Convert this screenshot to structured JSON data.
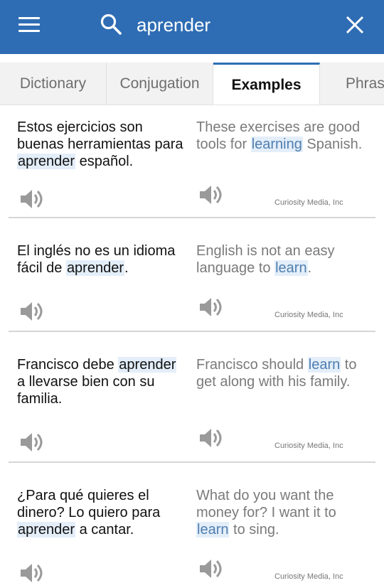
{
  "search": {
    "query": "aprender"
  },
  "tabs": [
    {
      "label": "Dictionary",
      "active": false
    },
    {
      "label": "Conjugation",
      "active": false
    },
    {
      "label": "Examples",
      "active": true
    },
    {
      "label": "Phrases",
      "active": false
    }
  ],
  "examples": [
    {
      "es_before": "Estos ejercicios son buenas herramientas para ",
      "es_highlight": "aprender",
      "es_after": " español.",
      "en_before": "These exercises are good tools for ",
      "en_highlight": "learning",
      "en_after": " Spanish.",
      "credit": "Curiosity Media, Inc"
    },
    {
      "es_before": "El inglés no es un idioma fácil de ",
      "es_highlight": "aprender",
      "es_after": ".",
      "en_before": "English is not an easy language to ",
      "en_highlight": "learn",
      "en_after": ".",
      "credit": "Curiosity Media, Inc"
    },
    {
      "es_before": "Francisco debe ",
      "es_highlight": "aprender",
      "es_after": " a llevarse bien con su familia.",
      "en_before": "Francisco should ",
      "en_highlight": "learn",
      "en_after": " to get along with his family.",
      "credit": "Curiosity Media, Inc"
    },
    {
      "es_before": "¿Para qué quieres el dinero? Lo quiero para ",
      "es_highlight": "aprender",
      "es_after": " a cantar.",
      "en_before": "What do you want the money for? I want it to ",
      "en_highlight": "learn",
      "en_after": " to sing.",
      "credit": "Curiosity Media, Inc"
    }
  ],
  "colors": {
    "appbar": "#2e6db4",
    "highlight_bg": "#e3eef9",
    "highlight_text_en": "#4f7eb0"
  },
  "icons": [
    "menu-icon",
    "search-icon",
    "close-icon",
    "speaker-icon"
  ]
}
